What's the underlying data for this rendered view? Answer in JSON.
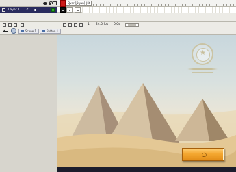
{
  "timeline": {
    "layer_name": "Layer 1",
    "layer_check": "✓",
    "scene_label": "Over [Down] Hit",
    "frames": [
      "•",
      "•"
    ]
  },
  "statusbar": {
    "frame_number": "1",
    "fps": "24.0 fps",
    "elapsed": "0.0s"
  },
  "editbar": {
    "scene": "Scene 1",
    "symbol": "Button 1"
  },
  "stage": {
    "button_glyph": "○"
  },
  "colors": {
    "layer_bg": "#2a2c5e",
    "playhead": "#cc1a1a",
    "button_orange": "#f4a730"
  }
}
